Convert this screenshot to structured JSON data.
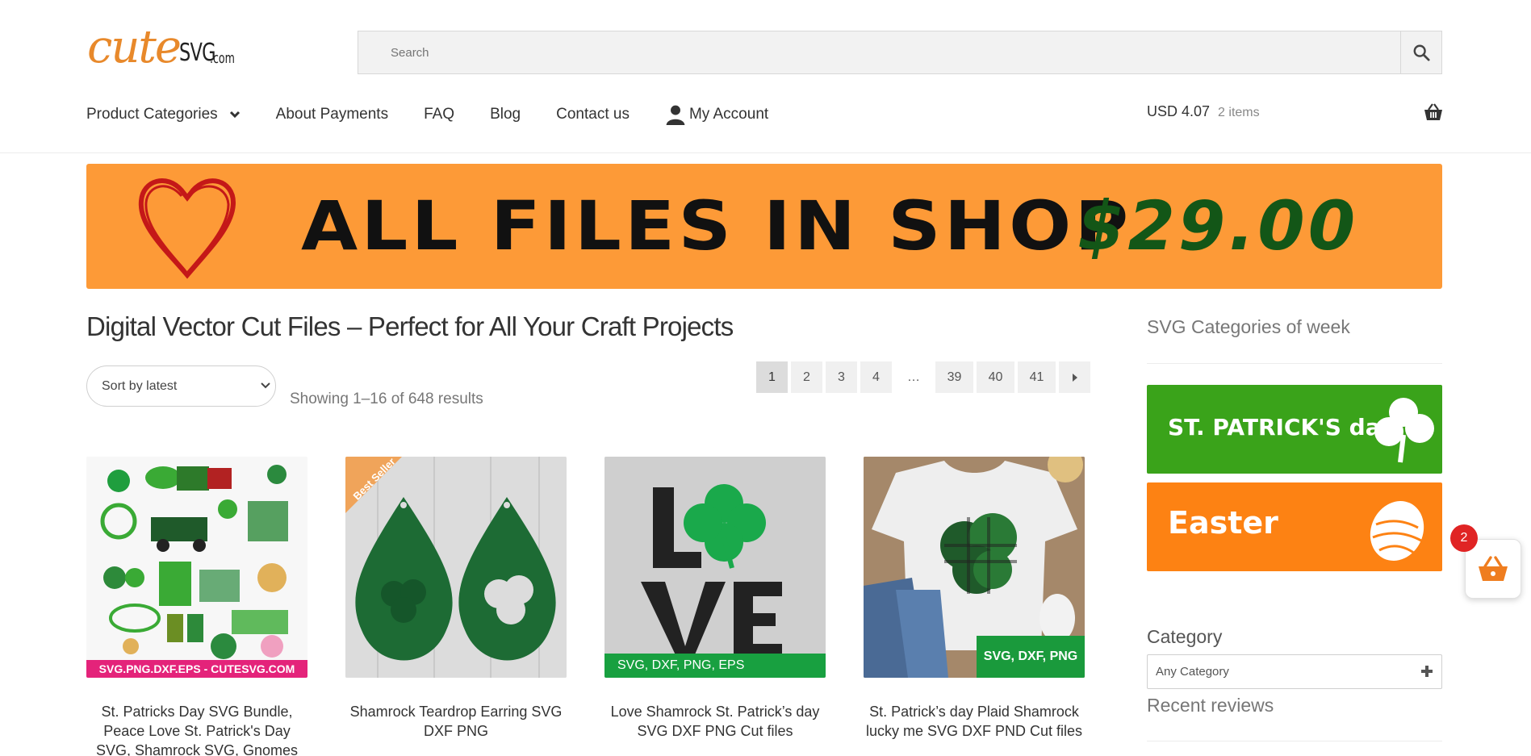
{
  "brand": {
    "logo_cute": "cute",
    "logo_svg": "SVG",
    "logo_com": ".com"
  },
  "search": {
    "placeholder": "Search"
  },
  "nav": {
    "items": [
      {
        "label": "Product Categories"
      },
      {
        "label": "About Payments"
      },
      {
        "label": "FAQ"
      },
      {
        "label": "Blog"
      },
      {
        "label": "Contact us"
      },
      {
        "label": "My Account"
      }
    ]
  },
  "cart": {
    "amount": "USD 4.07",
    "items": "2 items",
    "badge_count": "2"
  },
  "banner": {
    "text": "ALL FILES IN SHOP",
    "price": "$29.00"
  },
  "main": {
    "title": "Digital Vector Cut Files – Perfect for All Your Craft Projects",
    "sort": {
      "selected": "Sort by latest"
    },
    "results": "Showing 1–16 of 648 results",
    "pagination": [
      "1",
      "2",
      "3",
      "4",
      "…",
      "39",
      "40",
      "41"
    ],
    "products": [
      {
        "name": "St. Patricks Day SVG Bundle, Peace Love St. Patrick's Day SVG, Shamrock SVG, Gnomes St.",
        "thumb_caption": "SVG.PNG.DXF.EPS - CUTESVG.COM"
      },
      {
        "name": "Shamrock Teardrop Earring SVG DXF PNG",
        "thumb_caption": "Best Seller"
      },
      {
        "name": "Love Shamrock St. Patrick’s day SVG DXF PNG Cut files",
        "thumb_caption": "SVG, DXF, PNG, EPS"
      },
      {
        "name": "St. Patrick’s day Plaid Shamrock lucky me SVG DXF PND Cut files",
        "thumb_caption": "SVG, DXF, PNG"
      }
    ]
  },
  "sidebar": {
    "title": "SVG Categories of week",
    "banners": [
      {
        "label": "ST. PATRICK'S day",
        "color": "#3aa31a"
      },
      {
        "label": "Easter",
        "color": "#fd8213"
      }
    ],
    "category_label": "Category",
    "category_select": "Any Category",
    "recent_reviews": "Recent reviews"
  },
  "colors": {
    "banner_orange": "#fd9a37",
    "price_green": "#135617",
    "badge_red": "#e02424",
    "cart_orange": "#ef7d1f"
  }
}
